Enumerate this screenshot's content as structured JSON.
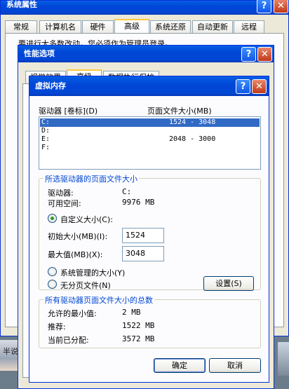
{
  "sysprops": {
    "title": "系统属性",
    "tabs": [
      "常规",
      "计算机名",
      "硬件",
      "高级",
      "系统还原",
      "自动更新",
      "远程"
    ],
    "notice": "要进行大多数改动，您必须作为管理员登录。"
  },
  "perf": {
    "title": "性能选项",
    "tabs": [
      "视觉效果",
      "高级",
      "数据执行保护"
    ]
  },
  "vm": {
    "title": "虚拟内存",
    "col_drive": "驱动器 [卷标](D)",
    "col_size": "页面文件大小(MB)",
    "drives": [
      {
        "drive": "C:",
        "size": "1524 - 3048"
      },
      {
        "drive": "D:",
        "size": ""
      },
      {
        "drive": "E:",
        "size": "2048 - 3000"
      },
      {
        "drive": "F:",
        "size": ""
      }
    ],
    "selected": {
      "group_title": "所选驱动器的页面文件大小",
      "drive_label": "驱动器:",
      "drive_value": "C:",
      "free_label": "可用空间:",
      "free_value": "9976 MB",
      "custom_label": "自定义大小(C):",
      "initial_label": "初始大小(MB)(I):",
      "initial_value": "1524",
      "max_label": "最大值(MB)(X):",
      "max_value": "3048",
      "system_label": "系统管理的大小(Y)",
      "none_label": "无分页文件(N)",
      "set_button": "设置(S)"
    },
    "totals": {
      "group_title": "所有驱动器页面文件大小的总数",
      "min_label": "允许的最小值:",
      "min_value": "2 MB",
      "rec_label": "推荐:",
      "rec_value": "1522 MB",
      "cur_label": "当前已分配:",
      "cur_value": "3572 MB"
    },
    "ok_button": "确定",
    "cancel_button": "取消"
  },
  "background_fragment": "半说",
  "icons": {
    "help": "help-icon",
    "close": "close-icon"
  },
  "colors": {
    "title_blue": "#0045d6",
    "selection": "#316ac5",
    "group_label": "#0046d5"
  }
}
